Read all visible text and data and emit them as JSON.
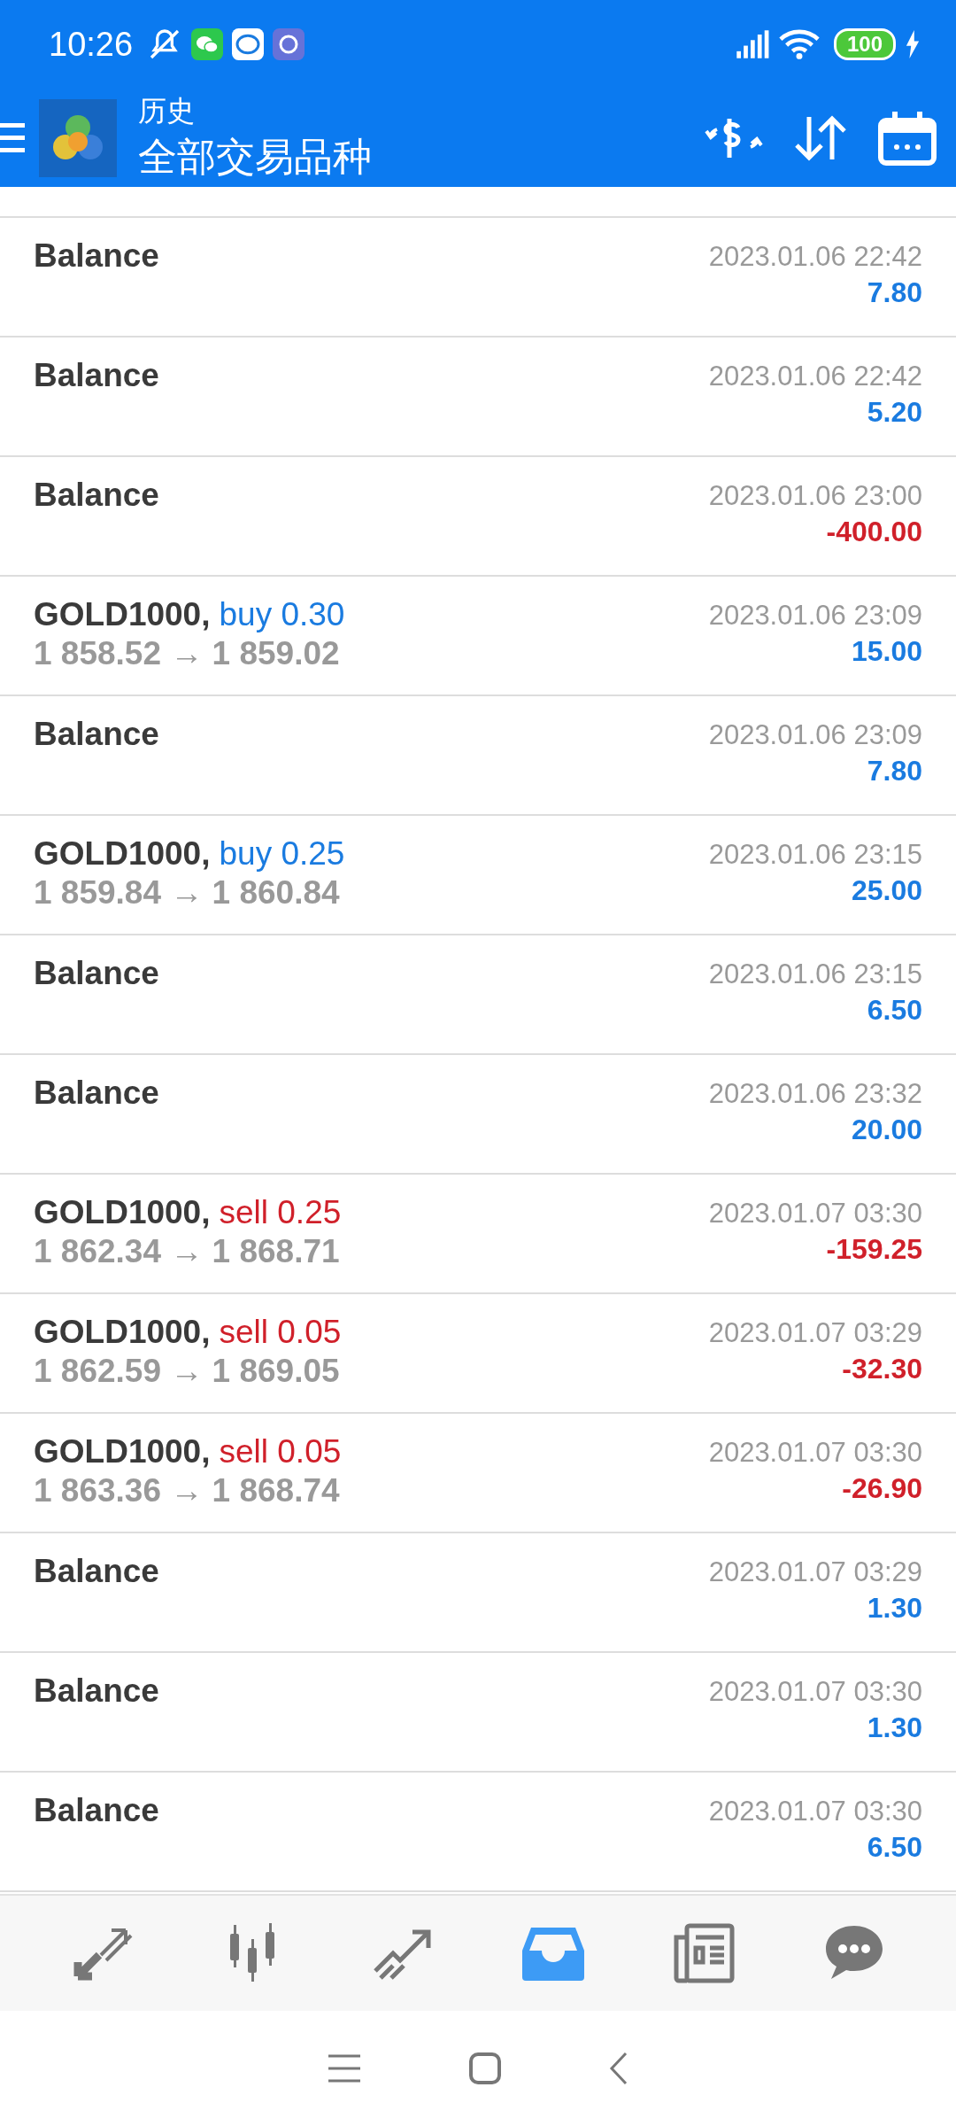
{
  "status_bar": {
    "time": "10:26",
    "battery": "100"
  },
  "app_bar": {
    "title": "历史",
    "subtitle": "全部交易品种"
  },
  "rows": [
    {
      "kind": "balance",
      "title": "Balance",
      "time": "2023.01.06 22:42",
      "profit": {
        "text": "7.80",
        "color": "#1a7be0"
      }
    },
    {
      "kind": "balance",
      "title": "Balance",
      "time": "2023.01.06 22:42",
      "profit": {
        "text": "5.20",
        "color": "#1a7be0"
      }
    },
    {
      "kind": "balance",
      "title": "Balance",
      "time": "2023.01.06 23:00",
      "profit": {
        "text": "-400.00",
        "color": "#d0202a"
      }
    },
    {
      "kind": "trade",
      "title": "GOLD1000,",
      "order": {
        "text": "buy 0.30",
        "color": "#1a7be0"
      },
      "prices": "1 858.52 → 1 859.02",
      "time": "2023.01.06 23:09",
      "profit": {
        "text": "15.00",
        "color": "#1a7be0"
      }
    },
    {
      "kind": "balance",
      "title": "Balance",
      "time": "2023.01.06 23:09",
      "profit": {
        "text": "7.80",
        "color": "#1a7be0"
      }
    },
    {
      "kind": "trade",
      "title": "GOLD1000,",
      "order": {
        "text": "buy 0.25",
        "color": "#1a7be0"
      },
      "prices": "1 859.84 → 1 860.84",
      "time": "2023.01.06 23:15",
      "profit": {
        "text": "25.00",
        "color": "#1a7be0"
      }
    },
    {
      "kind": "balance",
      "title": "Balance",
      "time": "2023.01.06 23:15",
      "profit": {
        "text": "6.50",
        "color": "#1a7be0"
      }
    },
    {
      "kind": "balance",
      "title": "Balance",
      "time": "2023.01.06 23:32",
      "profit": {
        "text": "20.00",
        "color": "#1a7be0"
      }
    },
    {
      "kind": "trade",
      "title": "GOLD1000,",
      "order": {
        "text": "sell 0.25",
        "color": "#d0202a"
      },
      "prices": "1 862.34 → 1 868.71",
      "time": "2023.01.07 03:30",
      "profit": {
        "text": "-159.25",
        "color": "#d0202a"
      }
    },
    {
      "kind": "trade",
      "title": "GOLD1000,",
      "order": {
        "text": "sell 0.05",
        "color": "#d0202a"
      },
      "prices": "1 862.59 → 1 869.05",
      "time": "2023.01.07 03:29",
      "profit": {
        "text": "-32.30",
        "color": "#d0202a"
      }
    },
    {
      "kind": "trade",
      "title": "GOLD1000,",
      "order": {
        "text": "sell 0.05",
        "color": "#d0202a"
      },
      "prices": "1 863.36 → 1 868.74",
      "time": "2023.01.07 03:30",
      "profit": {
        "text": "-26.90",
        "color": "#d0202a"
      }
    },
    {
      "kind": "balance",
      "title": "Balance",
      "time": "2023.01.07 03:29",
      "profit": {
        "text": "1.30",
        "color": "#1a7be0"
      }
    },
    {
      "kind": "balance",
      "title": "Balance",
      "time": "2023.01.07 03:30",
      "profit": {
        "text": "1.30",
        "color": "#1a7be0"
      }
    },
    {
      "kind": "balance",
      "title": "Balance",
      "time": "2023.01.07 03:30",
      "profit": {
        "text": "6.50",
        "color": "#1a7be0"
      }
    }
  ],
  "bottom_nav": [
    {
      "kind": "quotes",
      "selected": false
    },
    {
      "kind": "chart",
      "selected": false
    },
    {
      "kind": "trade",
      "selected": false
    },
    {
      "kind": "history",
      "selected": true
    },
    {
      "kind": "news",
      "selected": false
    },
    {
      "kind": "chat",
      "selected": false
    }
  ]
}
